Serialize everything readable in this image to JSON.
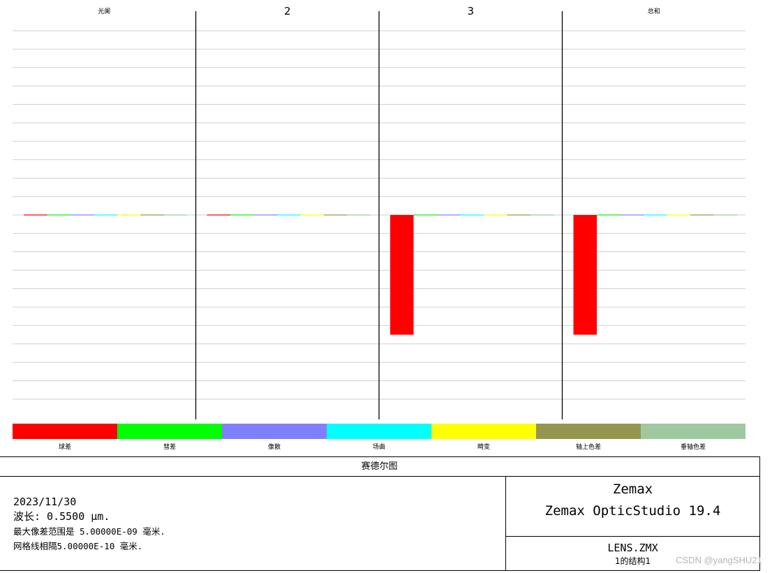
{
  "chart_data": {
    "type": "bar",
    "groups": [
      "光阑",
      "2",
      "3",
      "总和"
    ],
    "series": [
      {
        "name": "球差",
        "color": "#ff0000",
        "values": [
          0,
          0,
          -0.65,
          -0.65
        ]
      },
      {
        "name": "彗差",
        "color": "#00ff00",
        "values": [
          0,
          0,
          0,
          0
        ]
      },
      {
        "name": "像散",
        "color": "#8080ff",
        "values": [
          0,
          0,
          0,
          0
        ]
      },
      {
        "name": "场曲",
        "color": "#00ffff",
        "values": [
          0,
          0,
          0,
          0
        ]
      },
      {
        "name": "畸变",
        "color": "#ffff00",
        "values": [
          0,
          0,
          0,
          0
        ]
      },
      {
        "name": "轴上色差",
        "color": "#969650",
        "values": [
          0,
          0,
          0,
          0
        ]
      },
      {
        "name": "垂轴色差",
        "color": "#a0c8a0",
        "values": [
          0,
          0,
          0,
          0
        ]
      }
    ],
    "ylim": [
      -1,
      1
    ],
    "grid_lines": 21,
    "grid": true,
    "legend_placement": "bottom"
  },
  "info": {
    "title": "赛德尔图",
    "date": "2023/11/30",
    "wavelength": "波长: 0.5500 µm.",
    "max_range": "最大像差范围是 5.00000E-09 毫米.",
    "grid_spacing": "网格线相隔5.00000E-10 毫米.",
    "brand": "Zemax",
    "product": "Zemax OpticStudio 19.4",
    "file": "LENS.ZMX",
    "config": "1的结构1"
  },
  "watermark": "CSDN @yangSHU21"
}
